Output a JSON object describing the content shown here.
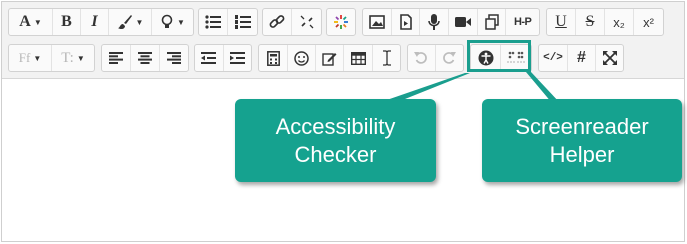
{
  "toolbar": {
    "font_label": "A",
    "bold_label": "B",
    "italic_label": "I",
    "h5p_label": "H-P",
    "underline_label": "U",
    "strike_label": "S",
    "subscript_label": "x₂",
    "superscript_label": "x²",
    "font_family_label": "Ff",
    "font_size_label": "T:",
    "hash_label": "#",
    "code_label": "</>"
  },
  "callouts": {
    "accessibility_label": "Accessibility Checker",
    "screenreader_label": "Screenreader Helper"
  },
  "colors": {
    "callout_bg": "#15a28f",
    "highlight_border": "#1a9e8e"
  }
}
